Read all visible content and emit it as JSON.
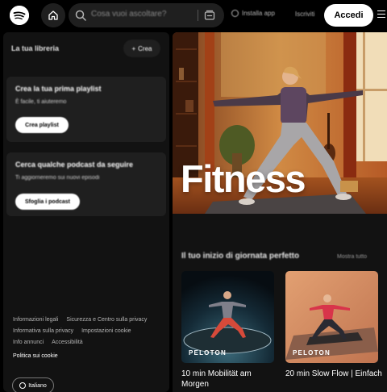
{
  "header": {
    "search_placeholder": "Cosa vuoi ascoltare?",
    "install_app": "Installa app",
    "signup": "Iscriviti",
    "login": "Accedi"
  },
  "sidebar": {
    "title": "La tua libreria",
    "create": "Crea",
    "playlist_card": {
      "title": "Crea la tua prima playlist",
      "subtitle": "È facile, ti aiuteremo",
      "button": "Crea playlist"
    },
    "podcast_card": {
      "title": "Cerca qualche podcast da seguire",
      "subtitle": "Ti aggiorneremo sui nuovi episodi",
      "button": "Sfoglia i podcast"
    },
    "legal_links": [
      "Informazioni legali",
      "Sicurezza e Centro sulla privacy",
      "Informativa sulla privacy",
      "Impostazioni cookie",
      "Info annunci",
      "Accessibilità"
    ],
    "cookie_policy": "Politica sui cookie",
    "language": "Italiano"
  },
  "main": {
    "hero_title": "Fitness",
    "section_title": "Il tuo inizio di giornata perfetto",
    "show_all": "Mostra tutto",
    "tiles": [
      {
        "brand": "PELOTON",
        "title": "10 min Mobilität am Morgen"
      },
      {
        "brand": "PELOTON",
        "title": "20 min Slow Flow | Einfach"
      }
    ]
  },
  "colors": {
    "spotify_green": "#1ed760",
    "background": "#000000",
    "panel": "#121212",
    "card": "#1f1f1f"
  }
}
